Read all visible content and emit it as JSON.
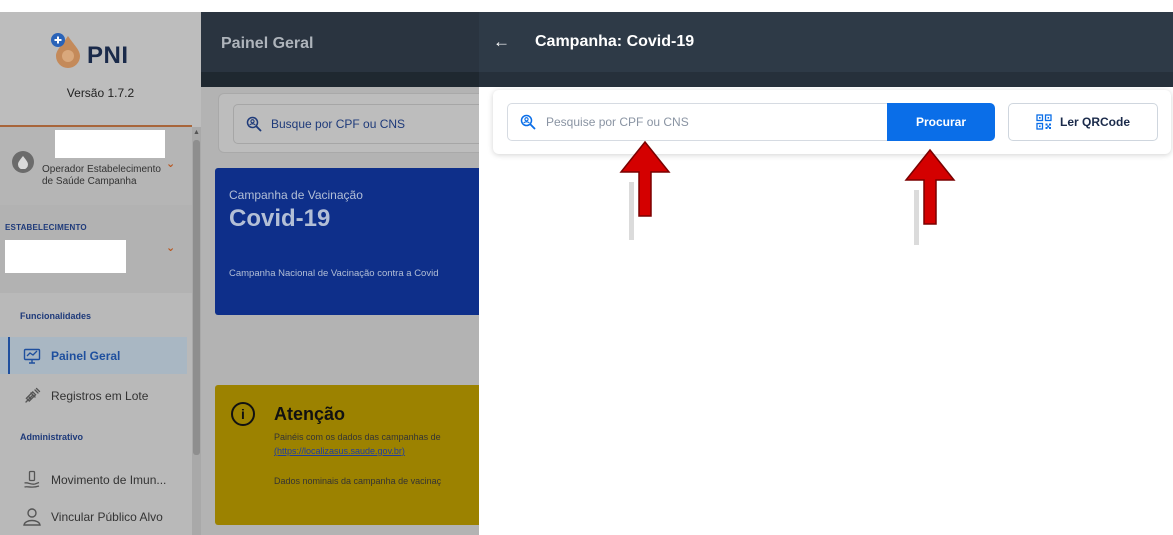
{
  "sidebar": {
    "logo_text": "PNI",
    "version": "Versão 1.7.2",
    "user_role": "Operador Estabelecimento de Saúde Campanha",
    "establishment_label": "ESTABELECIMENTO",
    "sections": {
      "features": "Funcionalidades",
      "admin": "Administrativo"
    },
    "items": [
      {
        "label": "Painel Geral",
        "icon": "monitor-icon"
      },
      {
        "label": "Registros em Lote",
        "icon": "syringe-icon"
      },
      {
        "label": "Movimento de Imun...",
        "icon": "vaccine-movement-icon"
      },
      {
        "label": "Vincular Público Alvo",
        "icon": "person-icon"
      }
    ]
  },
  "main": {
    "title": "Painel Geral",
    "search_placeholder": "Busque por CPF ou CNS",
    "campaign": {
      "label": "Campanha de Vacinação",
      "name": "Covid-19",
      "description": "Campanha Nacional de Vacinação contra a Covid"
    },
    "attention": {
      "title": "Atenção",
      "text1": "Painéis com os dados das campanhas de",
      "link": "(https://localizasus.saude.gov.br)",
      "text2": "Dados nominais da campanha de vacinaç"
    }
  },
  "drawer": {
    "title": "Campanha: Covid-19",
    "search": {
      "placeholder": "Pesquise por CPF ou CNS",
      "value": ""
    },
    "procurar_label": "Procurar",
    "qrcode_label": "Ler QRCode"
  },
  "colors": {
    "primary_button": "#0a6ee8",
    "header_dark": "#2e3a47",
    "annotation_arrow": "#d40000"
  }
}
